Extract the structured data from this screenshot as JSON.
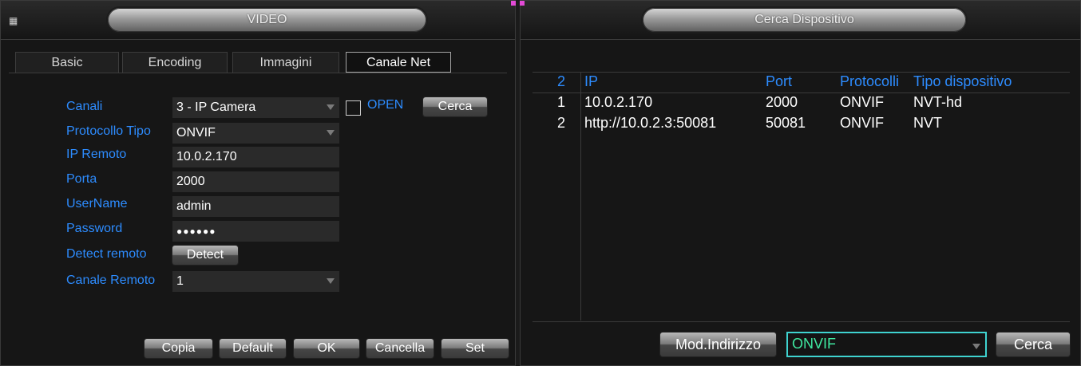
{
  "left_window": {
    "title": "VIDEO",
    "tabs": [
      "Basic",
      "Encoding",
      "Immagini",
      "Canale Net"
    ],
    "active_tab": "Canale Net",
    "form": {
      "canali_label": "Canali",
      "canali_value": "3 - IP Camera",
      "open_label": "OPEN",
      "cerca_label": "Cerca",
      "protocollo_label": "Protocollo Tipo",
      "protocollo_value": "ONVIF",
      "ip_label": "IP Remoto",
      "ip_value": "10.0.2.170",
      "porta_label": "Porta",
      "porta_value": "2000",
      "username_label": "UserName",
      "username_value": "admin",
      "password_label": "Password",
      "password_value": "●●●●●●",
      "detect_label": "Detect remoto",
      "detect_button": "Detect",
      "canale_remoto_label": "Canale Remoto",
      "canale_remoto_value": "1"
    },
    "buttons": {
      "copia": "Copia",
      "default": "Default",
      "ok": "OK",
      "cancella": "Cancella",
      "set": "Set"
    }
  },
  "right_window": {
    "title": "Cerca Dispositivo",
    "table": {
      "headers": [
        "2",
        "IP",
        "Port",
        "Protocolli",
        "Tipo dispositivo"
      ],
      "rows": [
        [
          "1",
          "10.0.2.170",
          "2000",
          "ONVIF",
          "NVT-hd"
        ],
        [
          "2",
          "http://10.0.2.3:50081",
          "50081",
          "ONVIF",
          "NVT"
        ]
      ]
    },
    "mod_button": "Mod.Indirizzo",
    "protocol_select": "ONVIF",
    "cerca_button": "Cerca"
  },
  "colors": {
    "label_blue": "#2d8cff",
    "select_border": "#3fd3d0",
    "select_text": "#3fe8a0",
    "corner_accent": "#e24ad6"
  }
}
